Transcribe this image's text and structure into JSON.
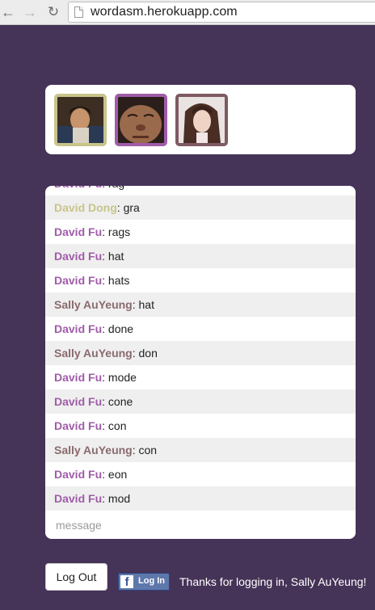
{
  "browser": {
    "url": "wordasm.herokuapp.com",
    "back_icon": "arrow-left-icon",
    "forward_icon": "arrow-right-icon",
    "reload_icon": "reload-icon"
  },
  "players": [
    {
      "color": "#c8c48a",
      "photo": "player-photo-1"
    },
    {
      "color": "#a05ca8",
      "photo": "player-photo-2"
    },
    {
      "color": "#7e5a63",
      "photo": "player-photo-3"
    }
  ],
  "chat": {
    "messages": [
      {
        "name": "David Fu",
        "text": "rag",
        "color": "#a05ca8"
      },
      {
        "name": "David Dong",
        "text": "gra",
        "color": "#c8c48a"
      },
      {
        "name": "David Fu",
        "text": "rags",
        "color": "#a05ca8"
      },
      {
        "name": "David Fu",
        "text": "hat",
        "color": "#a05ca8"
      },
      {
        "name": "David Fu",
        "text": "hats",
        "color": "#a05ca8"
      },
      {
        "name": "Sally AuYeung",
        "text": "hat",
        "color": "#8a6a6e"
      },
      {
        "name": "David Fu",
        "text": "done",
        "color": "#a05ca8"
      },
      {
        "name": "Sally AuYeung",
        "text": "don",
        "color": "#8a6a6e"
      },
      {
        "name": "David Fu",
        "text": "mode",
        "color": "#a05ca8"
      },
      {
        "name": "David Fu",
        "text": "cone",
        "color": "#a05ca8"
      },
      {
        "name": "David Fu",
        "text": "con",
        "color": "#a05ca8"
      },
      {
        "name": "Sally AuYeung",
        "text": "con",
        "color": "#8a6a6e"
      },
      {
        "name": "David Fu",
        "text": "eon",
        "color": "#a05ca8"
      },
      {
        "name": "David Fu",
        "text": "mod",
        "color": "#a05ca8"
      }
    ],
    "input_placeholder": "message"
  },
  "footer": {
    "logout_label": "Log Out",
    "fb_logo": "f",
    "fb_label": "Log In",
    "thanks_text": "Thanks for logging in, Sally AuYeung!"
  },
  "colors": {
    "background": "#463358",
    "row_shade": "#efefef"
  }
}
